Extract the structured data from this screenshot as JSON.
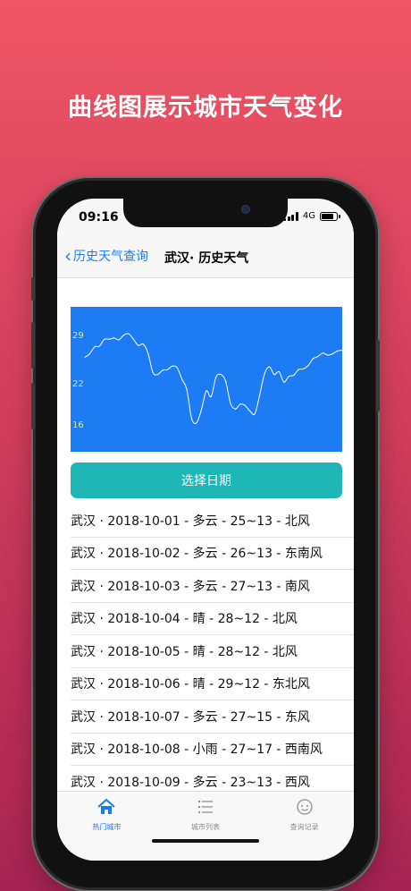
{
  "headline": "曲线图展示城市天气变化",
  "status_bar": {
    "time": "09:16",
    "network": "4G"
  },
  "nav": {
    "back_label": "历史天气查询",
    "title": "武汉· 历史天气"
  },
  "chart_data": {
    "type": "line",
    "title": "",
    "xlabel": "",
    "ylabel": "",
    "ytick_labels": [
      "29",
      "22",
      "16"
    ],
    "ylim": [
      12,
      33
    ],
    "grid": false,
    "line_color": "#ffffff",
    "background_color": "#1d7cf3",
    "tick_color": "#d9ef6a",
    "values": [
      25.7,
      26.2,
      27.2,
      27.3,
      28.3,
      28.3,
      28.5,
      28.2,
      28.9,
      29.1,
      28.3,
      27.4,
      27.6,
      26.3,
      23.5,
      23.2,
      23.8,
      23.9,
      24.4,
      24.2,
      22.5,
      21.0,
      16.8,
      16.2,
      18.1,
      20.8,
      20.0,
      22.8,
      23.2,
      22.2,
      19.0,
      18.2,
      18.9,
      18.7,
      17.9,
      17.5,
      20.2,
      23.3,
      24.3,
      23.2,
      23.6,
      22.1,
      22.9,
      23.1,
      23.9,
      24.0,
      24.5,
      25.5,
      25.8,
      26.3,
      26.0,
      26.2,
      26.6,
      26.7
    ]
  },
  "select_button": "选择日期",
  "rows": [
    "武汉 · 2018-10-01 - 多云 - 25~13 - 北风",
    "武汉 · 2018-10-02 - 多云 - 26~13 - 东南风",
    "武汉 · 2018-10-03 - 多云 - 27~13 - 南风",
    "武汉 · 2018-10-04 - 晴 - 28~12 - 北风",
    "武汉 · 2018-10-05 - 晴 - 28~12 - 北风",
    "武汉 · 2018-10-06 - 晴 - 29~12 - 东北风",
    "武汉 · 2018-10-07 - 多云 - 27~15 - 东风",
    "武汉 · 2018-10-08 - 小雨 - 27~17 - 西南风",
    "武汉 · 2018-10-09 - 多云 - 23~13 - 西风"
  ],
  "tabs": [
    {
      "label": "热门城市",
      "icon": "house-icon",
      "active": true
    },
    {
      "label": "城市列表",
      "icon": "list-icon",
      "active": false
    },
    {
      "label": "查询记录",
      "icon": "history-icon",
      "active": false
    }
  ],
  "colors": {
    "accent_blue": "#1a7cf2",
    "button_teal": "#1fb7b5",
    "bg_top": "#ee5565",
    "bg_bottom": "#a62452"
  }
}
